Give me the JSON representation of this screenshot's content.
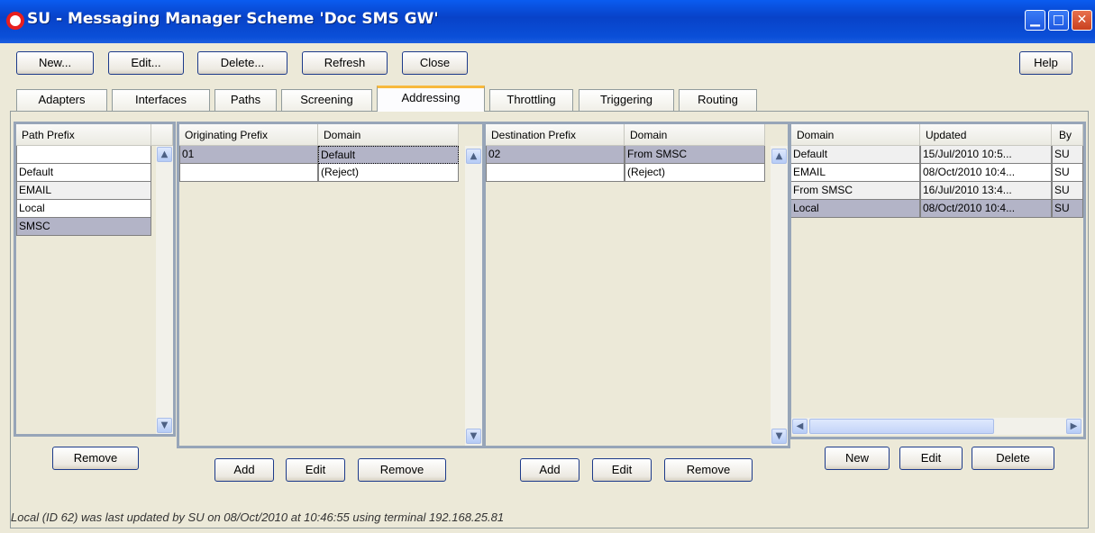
{
  "window": {
    "title": "SU - Messaging Manager Scheme 'Doc SMS GW'"
  },
  "toolbar": {
    "new": "New...",
    "edit": "Edit...",
    "delete": "Delete...",
    "refresh": "Refresh",
    "close": "Close",
    "help": "Help"
  },
  "tabs": [
    "Adapters",
    "Interfaces",
    "Paths",
    "Screening",
    "Addressing",
    "Throttling",
    "Triggering",
    "Routing"
  ],
  "active_tab": "Addressing",
  "path_panel": {
    "header": "Path Prefix",
    "rows": [
      "",
      "Default",
      "EMAIL",
      "Local",
      "SMSC"
    ],
    "remove": "Remove"
  },
  "orig_panel": {
    "headers": [
      "Originating Prefix",
      "Domain"
    ],
    "rows": [
      [
        "01",
        "Default"
      ],
      [
        "",
        "(Reject)"
      ]
    ],
    "add": "Add",
    "edit": "Edit",
    "remove": "Remove"
  },
  "dest_panel": {
    "headers": [
      "Destination Prefix",
      "Domain"
    ],
    "rows": [
      [
        "02",
        "From SMSC"
      ],
      [
        "",
        "(Reject)"
      ]
    ],
    "add": "Add",
    "edit": "Edit",
    "remove": "Remove"
  },
  "domain_panel": {
    "headers": [
      "Domain",
      "Updated",
      "By"
    ],
    "rows": [
      [
        "Default",
        "15/Jul/2010 10:5...",
        "SU"
      ],
      [
        "EMAIL",
        "08/Oct/2010 10:4...",
        "SU"
      ],
      [
        "From SMSC",
        "16/Jul/2010 13:4...",
        "SU"
      ],
      [
        "Local",
        "08/Oct/2010 10:4...",
        "SU"
      ]
    ],
    "new": "New",
    "edit": "Edit",
    "delete": "Delete"
  },
  "status": "Local (ID 62) was last updated by SU on 08/Oct/2010 at 10:46:55 using terminal 192.168.25.81",
  "icons": {
    "up": "▲",
    "down": "▼",
    "left": "◀",
    "right": "▶",
    "minimize": "▁",
    "maximize": "□",
    "close": "✕"
  }
}
